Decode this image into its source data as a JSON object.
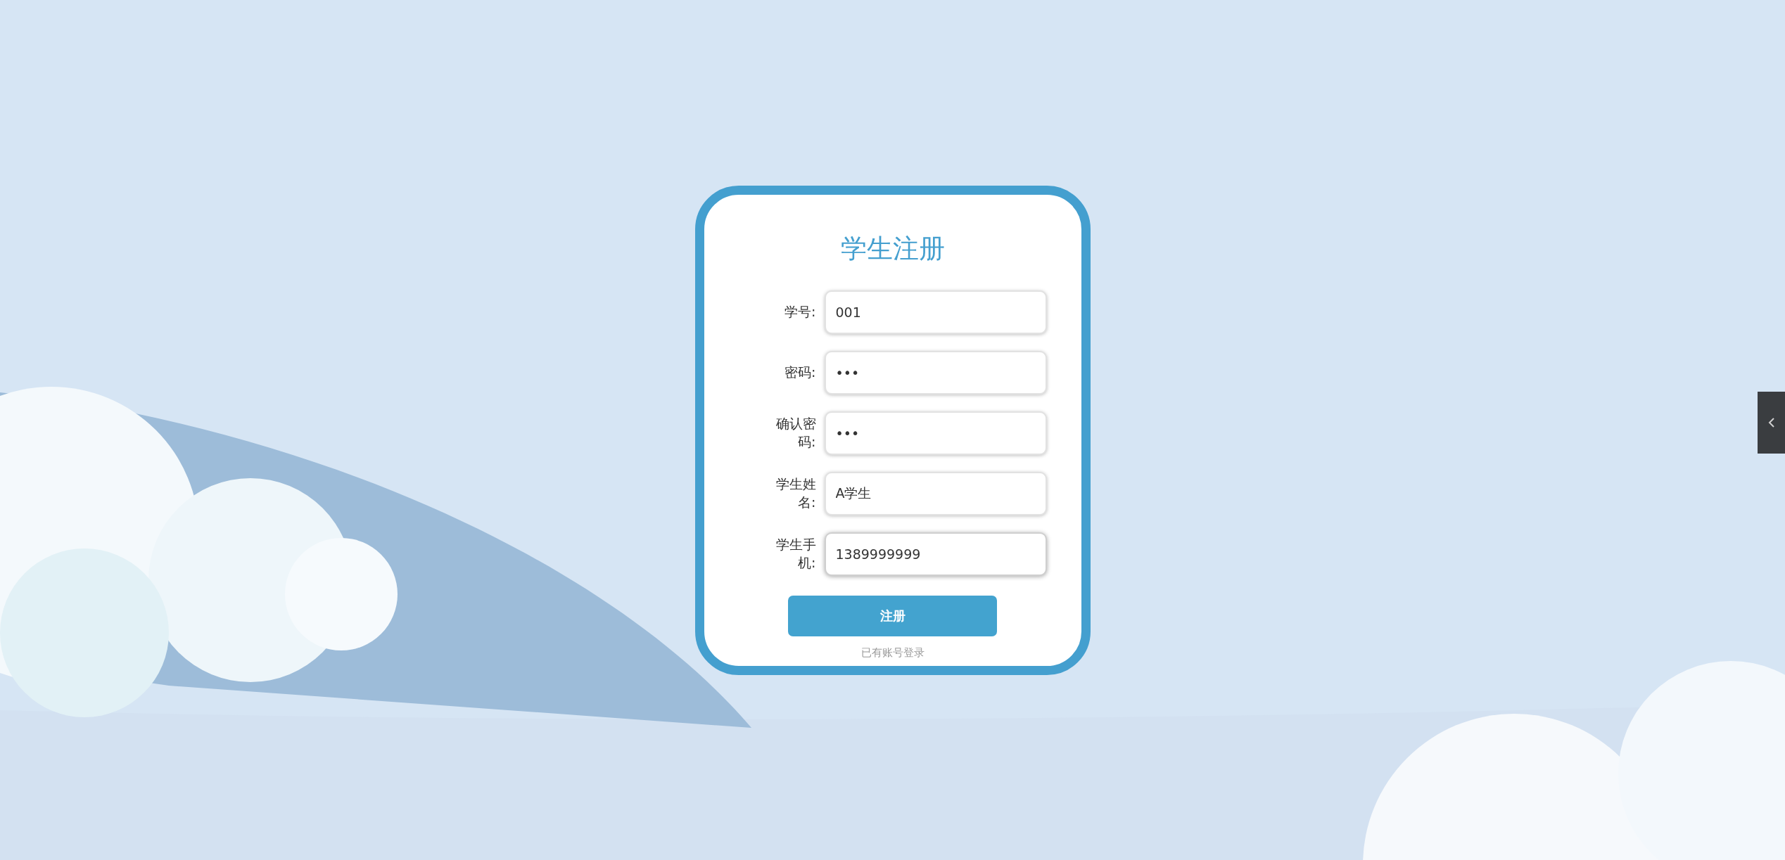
{
  "form": {
    "title": "学生注册",
    "fields": [
      {
        "label": "学号:",
        "value": "001",
        "focused": false
      },
      {
        "label": "密码:",
        "value": "•••",
        "focused": false
      },
      {
        "label": "确认密码:",
        "value": "•••",
        "focused": false
      },
      {
        "label": "学生姓名:",
        "value": "A学生",
        "focused": false
      },
      {
        "label": "学生手机:",
        "value": "1389999999",
        "focused": true
      }
    ],
    "submit": "注册",
    "login_link": "已有账号登录"
  }
}
